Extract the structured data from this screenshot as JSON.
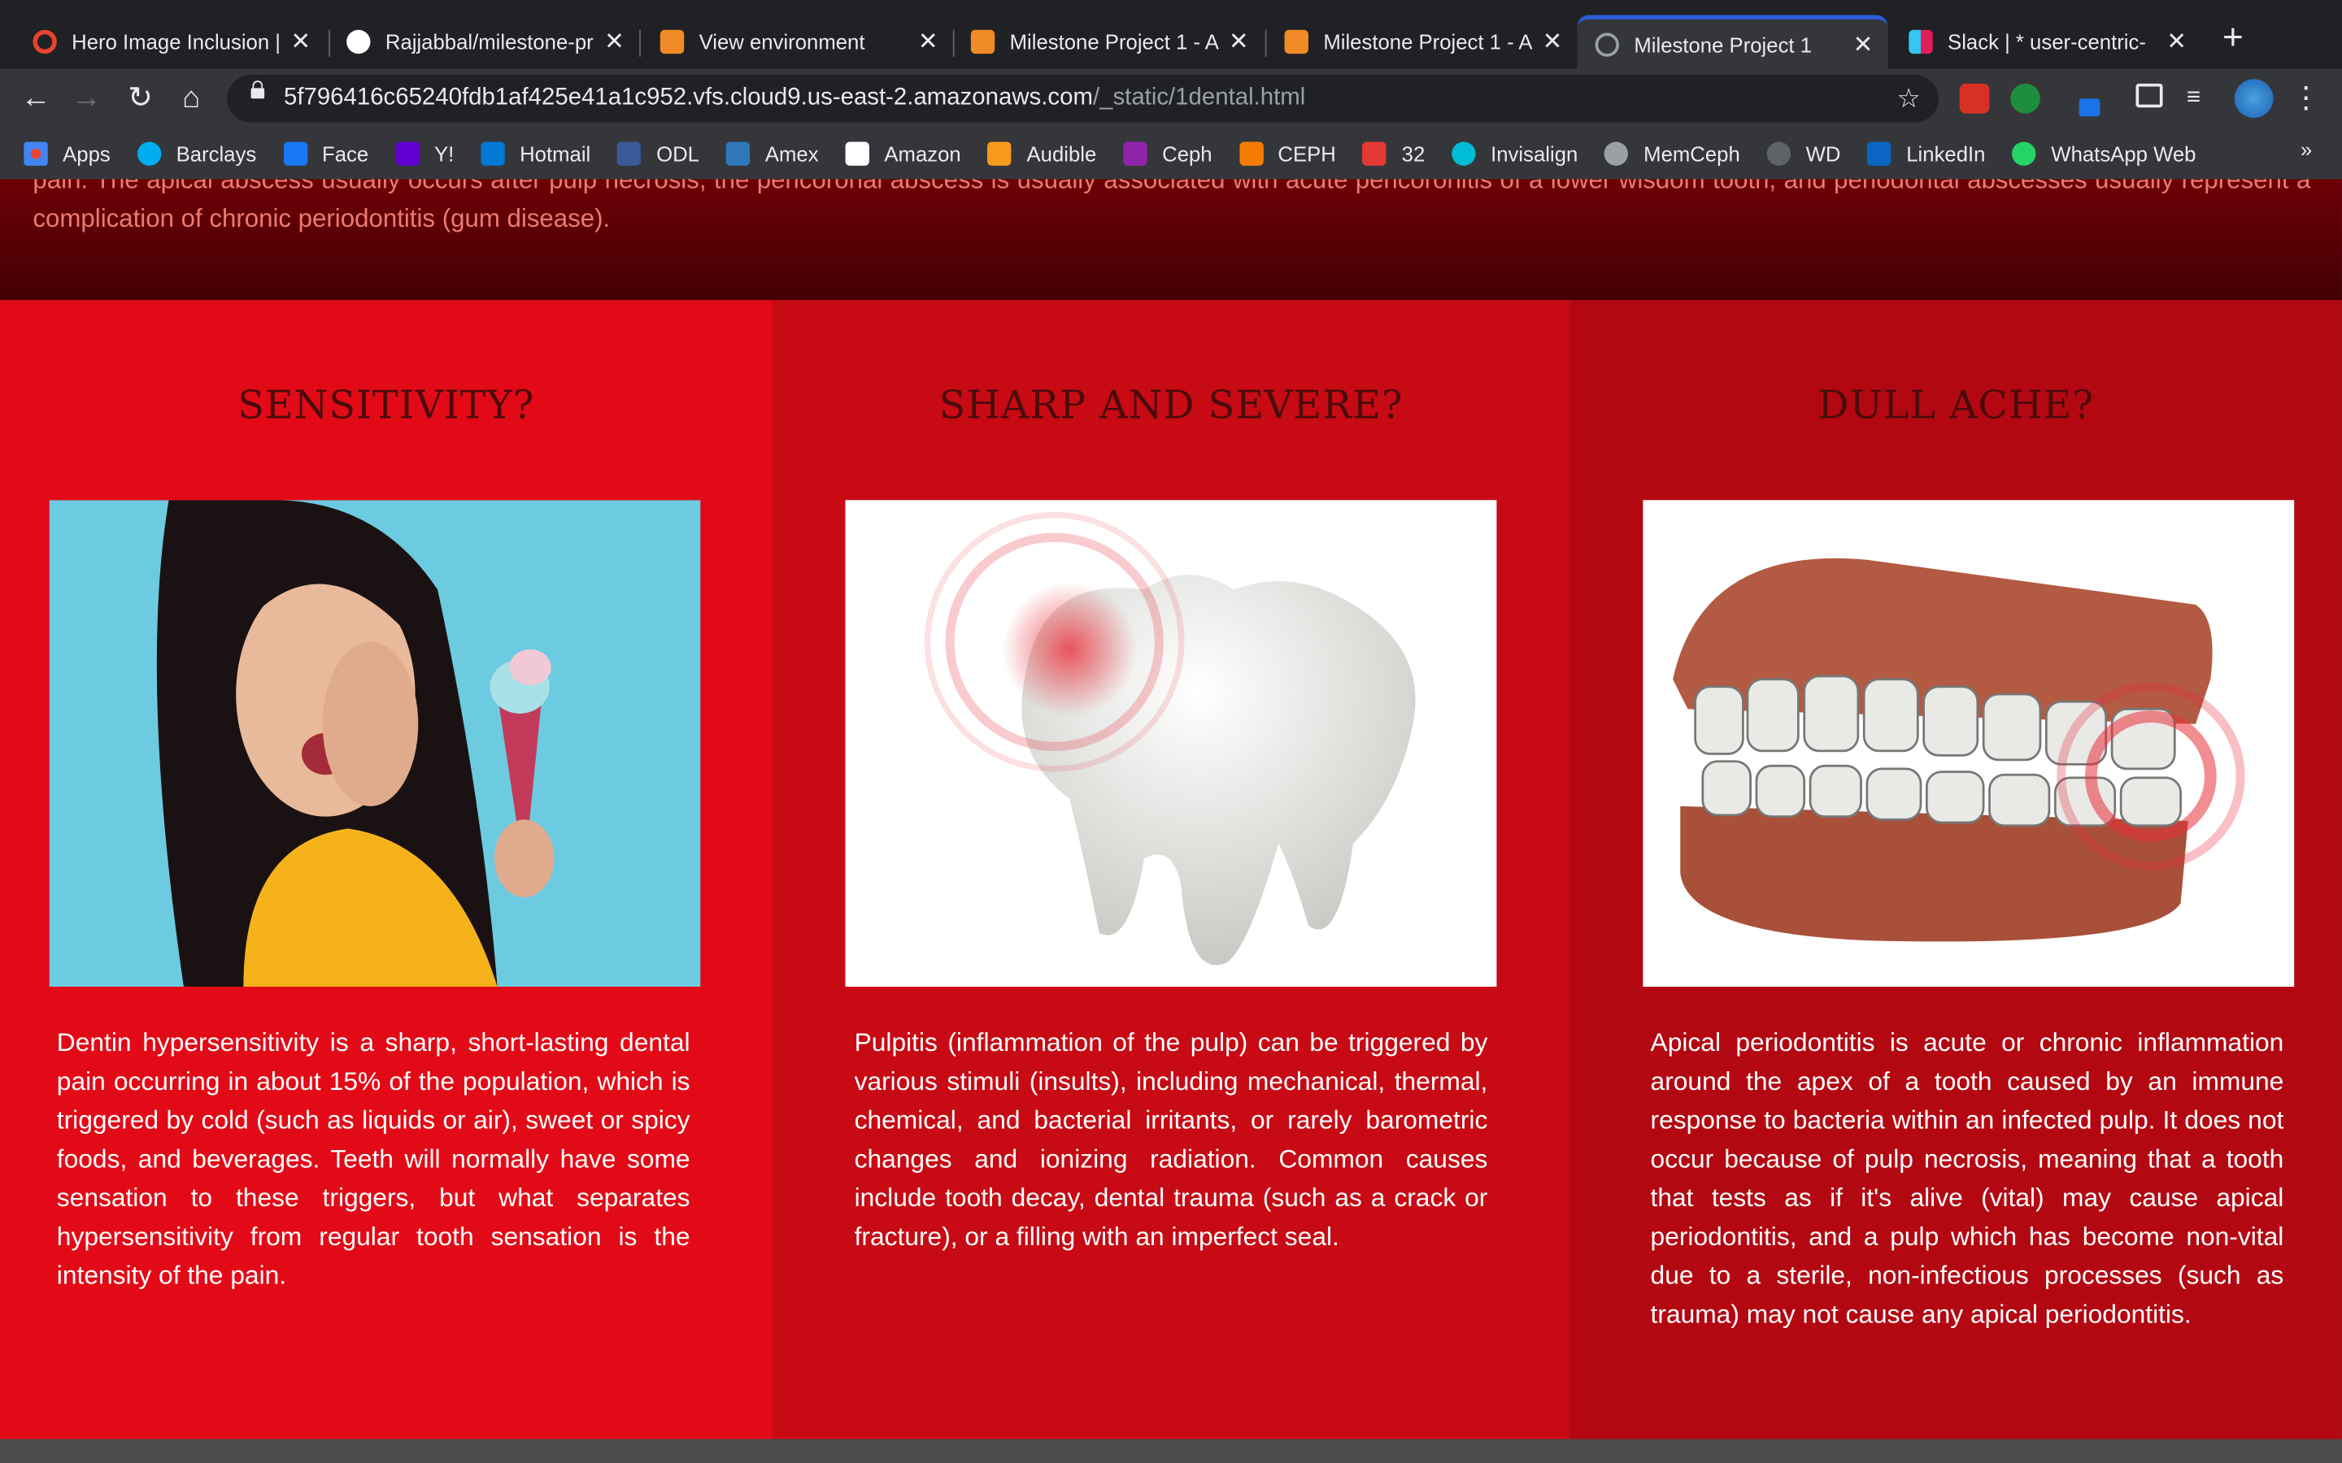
{
  "browser": {
    "tabs": [
      {
        "title": "Hero Image Inclusion |",
        "icon": "opera-icon",
        "color": "#e8442c"
      },
      {
        "title": "Rajjabbal/milestone-pr",
        "icon": "github-icon",
        "color": "#ffffff"
      },
      {
        "title": "View environment",
        "icon": "cloud9-icon",
        "color": "#f08a24"
      },
      {
        "title": "Milestone Project 1 - A",
        "icon": "cloud9-icon",
        "color": "#f08a24"
      },
      {
        "title": "Milestone Project 1 - A",
        "icon": "cloud9-icon",
        "color": "#f08a24"
      },
      {
        "title": "Milestone Project 1",
        "icon": "globe-icon",
        "color": "#9aa0a6",
        "active": true
      },
      {
        "title": "Slack | * user-centric-",
        "icon": "slack-icon",
        "color": "#e01e5a"
      }
    ],
    "url_host": "5f796416c65240fdb1af425e41a1c952.vfs.cloud9.us-east-2.amazonaws.com",
    "url_path": "/_static/1dental.html",
    "bookmarks": [
      {
        "label": "Apps",
        "icon": "apps-grid-icon",
        "color": "#4285f4"
      },
      {
        "label": "Barclays",
        "icon": "barclays-eagle-icon",
        "color": "#00aeef"
      },
      {
        "label": "Face",
        "icon": "facebook-icon",
        "color": "#1877f2"
      },
      {
        "label": "Y!",
        "icon": "yahoo-icon",
        "color": "#6001d2"
      },
      {
        "label": "Hotmail",
        "icon": "outlook-icon",
        "color": "#0078d4"
      },
      {
        "label": "ODL",
        "icon": "mail-icon",
        "color": "#3b5998"
      },
      {
        "label": "Amex",
        "icon": "amex-icon",
        "color": "#2e77bb"
      },
      {
        "label": "Amazon",
        "icon": "amazon-icon",
        "color": "#ffffff"
      },
      {
        "label": "Audible",
        "icon": "audible-icon",
        "color": "#f7991c"
      },
      {
        "label": "Ceph",
        "icon": "ceph-icon",
        "color": "#8e24aa"
      },
      {
        "label": "CEPH",
        "icon": "ceph-logo-icon",
        "color": "#f57c00"
      },
      {
        "label": "32",
        "icon": "thirtytwo-icon",
        "color": "#e53935"
      },
      {
        "label": "Invisalign",
        "icon": "invisalign-star-icon",
        "color": "#00bcd4"
      },
      {
        "label": "MemCeph",
        "icon": "globe-icon",
        "color": "#9aa0a6"
      },
      {
        "label": "WD",
        "icon": "cloud-icon",
        "color": "#5f6368"
      },
      {
        "label": "LinkedIn",
        "icon": "linkedin-icon",
        "color": "#0a66c2"
      },
      {
        "label": "WhatsApp Web",
        "icon": "whatsapp-icon",
        "color": "#25d366"
      }
    ],
    "bookmarks_more": "»"
  },
  "page": {
    "intro_text": "pain. The apical abscess usually occurs after pulp necrosis, the pericoronal abscess is usually associated with acute pericoronitis of a lower wisdom tooth, and periodontal abscesses usually represent a complication of chronic periodontitis (gum disease).",
    "columns": [
      {
        "heading": "SENSITIVITY?",
        "image": "woman-eating-ice-cream-toothache",
        "bg": "#e30a17",
        "text": "Dentin hypersensitivity is a sharp, short-lasting dental pain occurring in about 15% of the population, which is triggered by cold (such as liquids or air), sweet or spicy foods, and beverages. Teeth will normally have some sensation to these triggers, but what separates hypersensitivity from regular tooth sensation is the intensity of the pain."
      },
      {
        "heading": "SHARP AND SEVERE?",
        "image": "molar-tooth-pain",
        "bg": "#c70a14",
        "text": "Pulpitis (inflammation of the pulp) can be triggered by various stimuli (insults), including mechanical, thermal, chemical, and bacterial irritants, or rarely barometric changes and ionizing radiation. Common causes include tooth decay, dental trauma (such as a crack or fracture), or a filling with an imperfect seal."
      },
      {
        "heading": "DULL ACHE?",
        "image": "jaw-teeth-model-pain",
        "bg": "#b30812",
        "text": "Apical periodontitis is acute or chronic inflammation around the apex of a tooth caused by an immune response to bacteria within an infected pulp. It does not occur because of pulp necrosis, meaning that a tooth that tests as if it's alive (vital) may cause apical periodontitis, and a pulp which has become non-vital due to a sterile, non-infectious processes (such as trauma) may not cause any apical periodontitis."
      }
    ]
  }
}
